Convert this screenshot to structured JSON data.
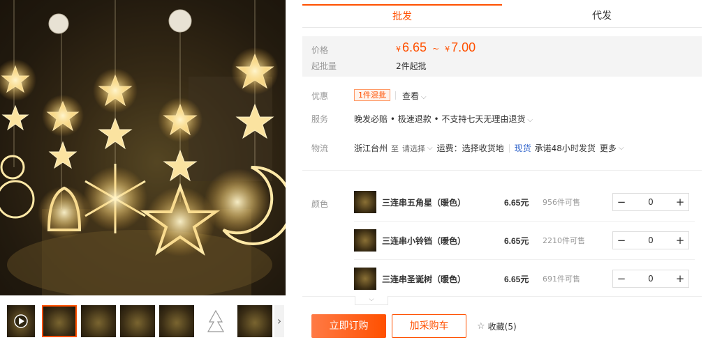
{
  "gallery": {
    "thumbnails": [
      {
        "name": "video-thumbnail",
        "type": "video"
      },
      {
        "name": "lights-thumbnail-1",
        "type": "image"
      },
      {
        "name": "lights-thumbnail-2",
        "type": "image"
      },
      {
        "name": "lights-thumbnail-3",
        "type": "image"
      },
      {
        "name": "lights-thumbnail-4",
        "type": "image"
      },
      {
        "name": "lights-thumbnail-5",
        "type": "image"
      },
      {
        "name": "lights-thumbnail-6",
        "type": "image"
      }
    ],
    "next_icon": "chevron-right-icon"
  },
  "tabs": [
    {
      "label": "批发",
      "active": true
    },
    {
      "label": "代发",
      "active": false
    }
  ],
  "price": {
    "label": "价格",
    "currency": "¥",
    "min": "6.65",
    "separator": "~",
    "max": "7.00",
    "moq_label": "起批量",
    "moq_value": "2件起批"
  },
  "promo": {
    "label": "优惠",
    "badge": "1件混批",
    "view": "查看"
  },
  "service": {
    "label": "服务",
    "text": "晚发必赔 • 极速退款 • 不支持七天无理由退货"
  },
  "logistics": {
    "label": "物流",
    "origin": "浙江台州",
    "to": "至",
    "select": "请选择",
    "freight": "运费：选择收货地",
    "stock_tag": "现货",
    "promise": "承诺48小时发货",
    "more": "更多"
  },
  "color": {
    "label": "颜色"
  },
  "skus": [
    {
      "name": "三连串五角星（暖色）",
      "price": "6.65元",
      "stock": "956件可售",
      "qty": "0"
    },
    {
      "name": "三连串小铃铛（暖色）",
      "price": "6.65元",
      "stock": "2210件可售",
      "qty": "0"
    },
    {
      "name": "三连串圣诞树（暖色）",
      "price": "6.65元",
      "stock": "691件可售",
      "qty": "0"
    }
  ],
  "stepper": {
    "minus": "−",
    "plus": "+"
  },
  "actions": {
    "buy_now": "立即订购",
    "add_cart": "加采购车",
    "favorite": "收藏(5)"
  },
  "colors": {
    "accent": "#ff5000",
    "link": "#3366cc"
  }
}
